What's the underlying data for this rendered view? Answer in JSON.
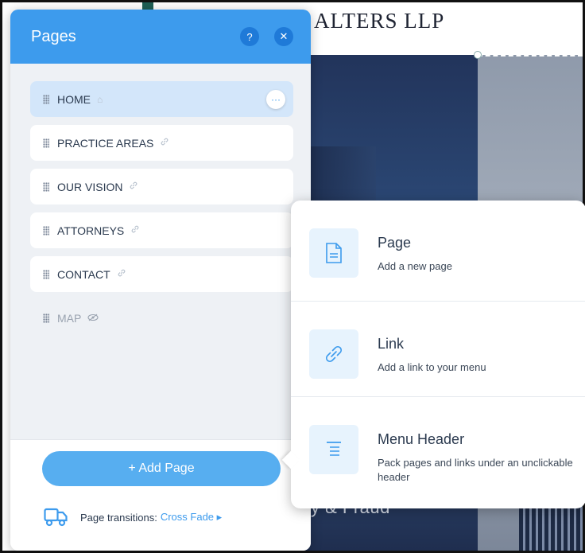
{
  "site": {
    "title": "ALTERS LLP",
    "hero_text": "y & Fraud"
  },
  "panel": {
    "title": "Pages",
    "help_icon": "?",
    "close_icon": "✕",
    "pages": [
      {
        "label": "HOME",
        "icon": "⌂",
        "more": "···"
      },
      {
        "label": "PRACTICE AREAS",
        "icon": "🔗"
      },
      {
        "label": "OUR VISION",
        "icon": "🔗"
      },
      {
        "label": "ATTORNEYS",
        "icon": "🔗"
      },
      {
        "label": "CONTACT",
        "icon": "🔗"
      },
      {
        "label": "MAP",
        "icon": "👁"
      }
    ],
    "add_page_label": "+ Add Page",
    "transitions_label": "Page transitions:",
    "transitions_value": "Cross Fade ▸"
  },
  "add_menu": {
    "options": [
      {
        "title": "Page",
        "desc": "Add a new page",
        "icon": "page-icon"
      },
      {
        "title": "Link",
        "desc": "Add a link to your menu",
        "icon": "link-icon"
      },
      {
        "title": "Menu Header",
        "desc": "Pack pages and links under an unclickable header",
        "icon": "menu-header-icon"
      }
    ]
  },
  "colors": {
    "accent": "#3d9bed",
    "panel_bg": "#eef1f5",
    "selected_item": "#d3e6fa"
  }
}
